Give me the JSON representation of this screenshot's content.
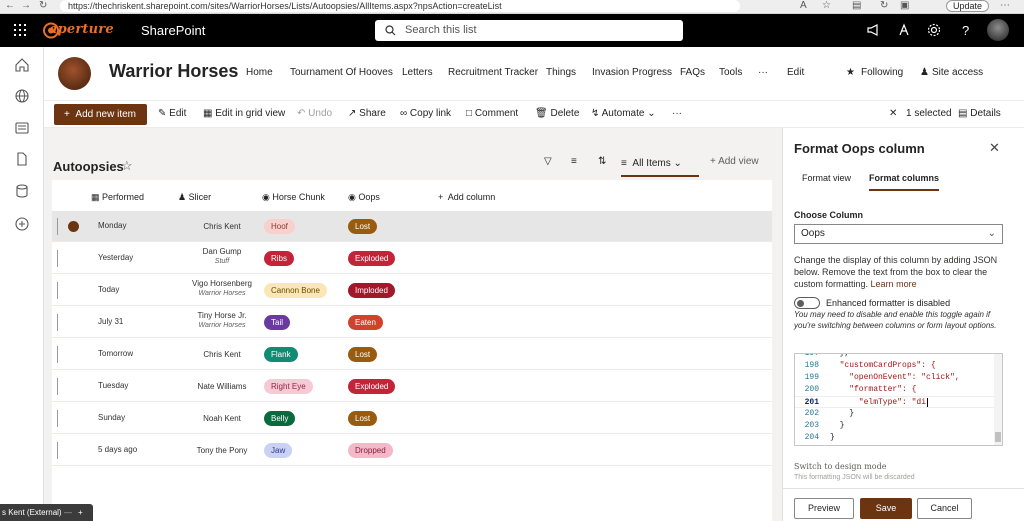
{
  "browser": {
    "url": "https://thechriskent.sharepoint.com/sites/WarriorHorses/Lists/Autoopsies/AllItems.aspx?npsAction=createList",
    "update_label": "Update"
  },
  "suite": {
    "logo": "aperture",
    "app_name": "SharePoint",
    "search_placeholder": "Search this list"
  },
  "site": {
    "title": "Warrior Horses",
    "nav": [
      "Home",
      "Tournament Of Hooves",
      "Letters",
      "Recruitment Tracker",
      "Things",
      "Invasion Progress",
      "FAQs",
      "Tools",
      "···",
      "Edit"
    ],
    "following_label": "Following",
    "site_access_label": "Site access"
  },
  "commands": {
    "add_new_item": "Add new item",
    "edit": "Edit",
    "edit_grid": "Edit in grid view",
    "undo": "Undo",
    "share": "Share",
    "copy_link": "Copy link",
    "comment": "Comment",
    "delete": "Delete",
    "automate": "Automate",
    "more": "···",
    "selected": "1 selected",
    "details": "Details"
  },
  "list": {
    "title": "Autoopsies",
    "view_name": "All Items",
    "add_view": "Add view",
    "columns": [
      "Performed",
      "Slicer",
      "Horse Chunk",
      "Oops",
      "Add column"
    ],
    "rows": [
      {
        "performed": "Monday",
        "slicer": "Chris Kent",
        "slicer_sub": "",
        "chunk": "Hoof",
        "oops": "Lost"
      },
      {
        "performed": "Yesterday",
        "slicer": "Dan Gump",
        "slicer_sub": "Stuff",
        "chunk": "Ribs",
        "oops": "Exploded"
      },
      {
        "performed": "Today",
        "slicer": "Vigo Horsenberg",
        "slicer_sub": "Warrior Horses",
        "chunk": "Cannon Bone",
        "oops": "Imploded"
      },
      {
        "performed": "July 31",
        "slicer": "Tiny Horse Jr.",
        "slicer_sub": "Warrior Horses",
        "chunk": "Tail",
        "oops": "Eaten"
      },
      {
        "performed": "Tomorrow",
        "slicer": "Chris Kent",
        "slicer_sub": "",
        "chunk": "Flank",
        "oops": "Lost"
      },
      {
        "performed": "Tuesday",
        "slicer": "Nate Williams",
        "slicer_sub": "",
        "chunk": "Right Eye",
        "oops": "Exploded"
      },
      {
        "performed": "Sunday",
        "slicer": "Noah Kent",
        "slicer_sub": "",
        "chunk": "Belly",
        "oops": "Lost"
      },
      {
        "performed": "5 days ago",
        "slicer": "Tony the Pony",
        "slicer_sub": "",
        "chunk": "Jaw",
        "oops": "Dropped"
      }
    ]
  },
  "panel": {
    "title": "Format Oops column",
    "tab_view": "Format view",
    "tab_columns": "Format columns",
    "choose_column_label": "Choose Column",
    "selected_column": "Oops",
    "description": "Change the display of this column by adding JSON below. Remove the text from the box to clear the custom formatting.",
    "learn_more": "Learn more",
    "toggle_label": "Enhanced formatter is disabled",
    "toggle_note": "You may need to disable and enable this toggle again if you're switching between columns or form layout options.",
    "code_lines": [
      {
        "n": "197",
        "text": "  },"
      },
      {
        "n": "198",
        "text": "  \"customCardProps\": {"
      },
      {
        "n": "199",
        "text": "    \"openOnEvent\": \"click\","
      },
      {
        "n": "200",
        "text": "    \"formatter\": {"
      },
      {
        "n": "201",
        "text": "      \"elmType\": \"di"
      },
      {
        "n": "202",
        "text": "    }"
      },
      {
        "n": "203",
        "text": "  }"
      },
      {
        "n": "204",
        "text": "}"
      }
    ],
    "switch_design": "Switch to design mode",
    "switch_note": "This formatting JSON will be discarded",
    "preview": "Preview",
    "save": "Save",
    "cancel": "Cancel"
  },
  "presence_tab": "s Kent (External)",
  "colors": {
    "accent": "#6d3411",
    "suite_bar": "#000000"
  }
}
